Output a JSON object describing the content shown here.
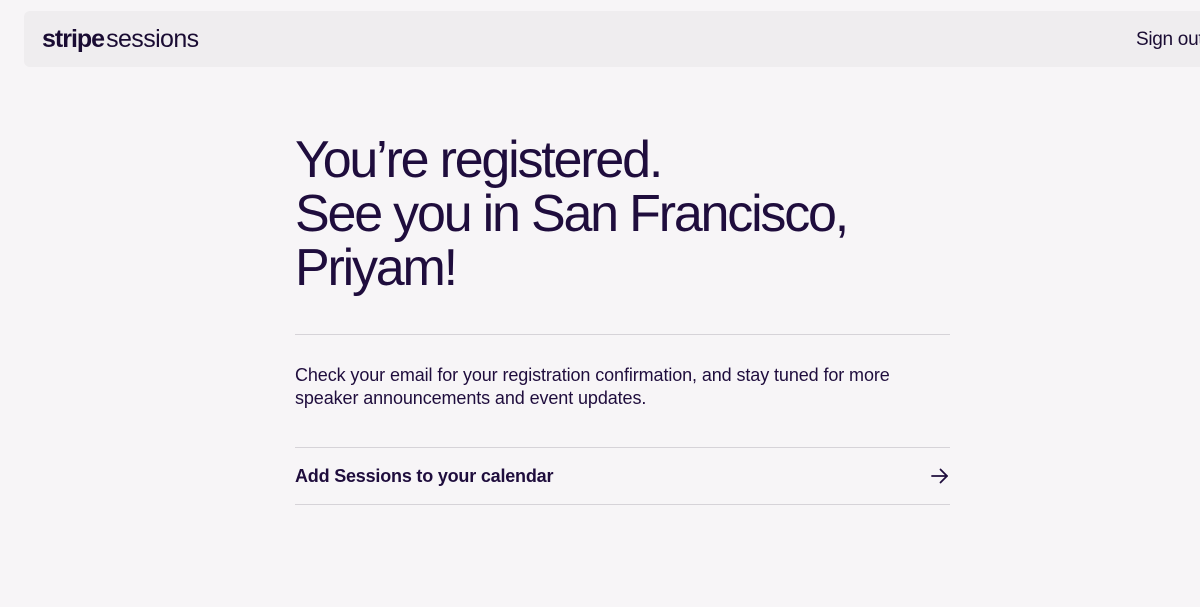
{
  "header": {
    "logo_primary": "stripe",
    "logo_secondary": "sessions",
    "sign_out_label": "Sign out"
  },
  "main": {
    "headline_lines": [
      "You’re registered.",
      "See you in San Francisco,",
      "Priyam!"
    ],
    "message": "Check your email for your registration confirmation, and stay tuned for more speaker announcements and event updates.",
    "calendar_link_label": "Add Sessions to your calendar",
    "calendar_link_icon": "arrow-right-icon"
  },
  "colors": {
    "background": "#f7f5f7",
    "header_background": "#efedef",
    "text_primary": "#1f0d3d",
    "divider": "#d6d3d8"
  }
}
